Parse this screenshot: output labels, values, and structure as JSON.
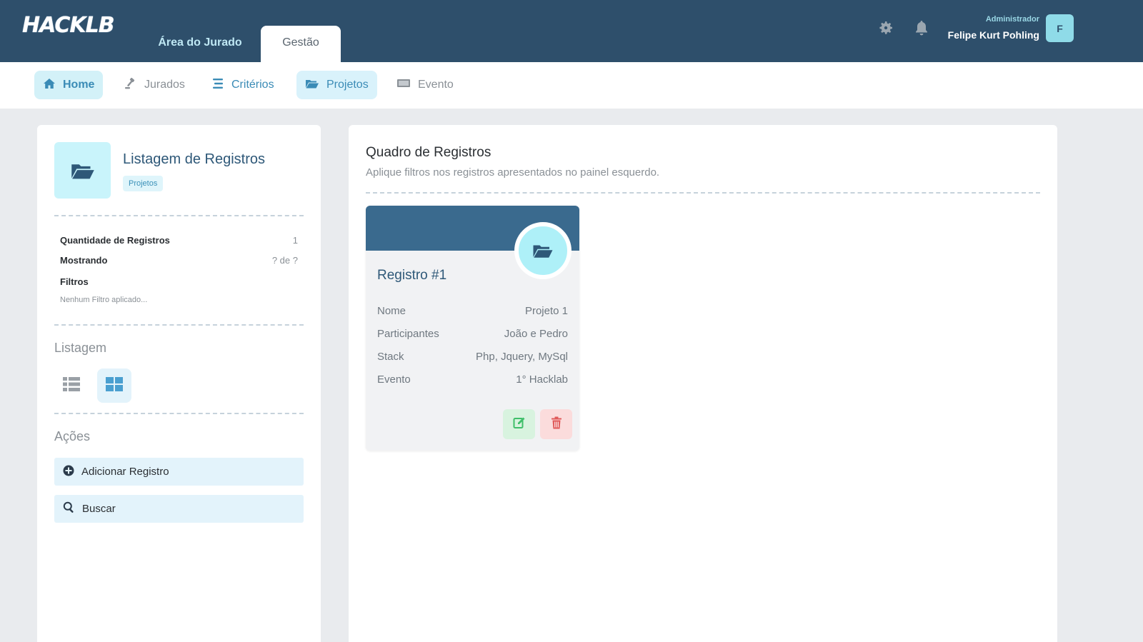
{
  "header": {
    "logo": "HACKLB",
    "tabs": [
      {
        "label": "Área do Jurado"
      },
      {
        "label": "Gestão"
      }
    ],
    "user": {
      "role": "Administrador",
      "name": "Felipe Kurt Pohling",
      "initial": "F"
    },
    "icons": {
      "settings": "gear-icon",
      "notifications": "bell-icon"
    }
  },
  "nav": {
    "items": [
      {
        "label": "Home",
        "icon": "home-icon"
      },
      {
        "label": "Jurados",
        "icon": "gavel-icon"
      },
      {
        "label": "Critérios",
        "icon": "list-icon"
      },
      {
        "label": "Projetos",
        "icon": "folder-open-icon"
      },
      {
        "label": "Evento",
        "icon": "monitor-icon"
      }
    ]
  },
  "left_panel": {
    "title": "Listagem de Registros",
    "badge": "Projetos",
    "stats": {
      "quantity_label": "Quantidade de Registros",
      "quantity_value": "1",
      "showing_label": "Mostrando",
      "showing_value": "? de ?",
      "filters_label": "Filtros",
      "filters_note": "Nenhum Filtro aplicado..."
    },
    "listing_heading": "Listagem",
    "actions_heading": "Ações",
    "actions": {
      "add_label": "Adicionar Registro",
      "search_label": "Buscar"
    }
  },
  "right_panel": {
    "title": "Quadro de Registros",
    "subtitle": "Aplique filtros nos registros apresentados no painel esquerdo.",
    "card": {
      "title": "Registro #1",
      "rows": [
        {
          "label": "Nome",
          "value": "Projeto 1"
        },
        {
          "label": "Participantes",
          "value": "João e Pedro"
        },
        {
          "label": "Stack",
          "value": "Php, Jquery, MySql"
        },
        {
          "label": "Evento",
          "value": "1° Hacklab"
        }
      ]
    }
  },
  "colors": {
    "header_bg": "#2e4f6b",
    "accent": "#3a8bb6",
    "card_head": "#3a6a8e",
    "tile_bg": "#c9f4fb"
  }
}
